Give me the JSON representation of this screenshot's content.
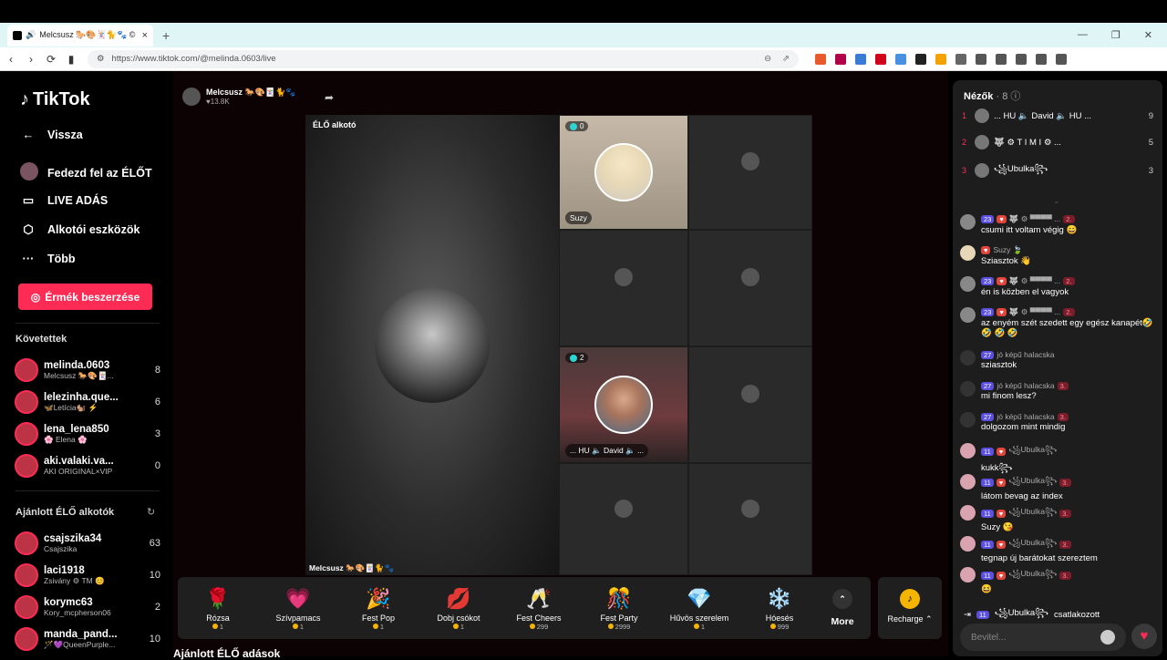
{
  "browser": {
    "tab_title": "Melcsusz 🐎🎨🃏🐈🐾 ©",
    "url": "https://www.tiktok.com/@melinda.0603/live"
  },
  "sidebar": {
    "logo": "TikTok",
    "nav": [
      {
        "label": "Vissza",
        "icon": "arrow-left-icon"
      },
      {
        "label": "Fedezd fel az ÉLŐT",
        "icon": "avatar"
      },
      {
        "label": "LIVE ADÁS",
        "icon": "video-camera-icon"
      },
      {
        "label": "Alkotói eszközök",
        "icon": "creator-tools-icon"
      },
      {
        "label": "Több",
        "icon": "more-dots-icon"
      }
    ],
    "coins_button": "Érmék beszerzése",
    "following_title": "Követettek",
    "following": [
      {
        "name": "melinda.0603",
        "sub": "Melcsusz 🐎🎨🃏...",
        "count": "8"
      },
      {
        "name": "lelezinha.que...",
        "sub": "🦋Letícia🐿️ ⚡",
        "count": "6"
      },
      {
        "name": "lena_lena850",
        "sub": "🌸 Elena 🌸",
        "count": "3"
      },
      {
        "name": "aki.valaki.va...",
        "sub": "AKI ORIGINAL×VIP",
        "count": "0"
      }
    ],
    "suggested_title": "Ajánlott ÉLŐ alkotók",
    "suggested": [
      {
        "name": "csajszika34",
        "sub": "Csajszika",
        "count": "63"
      },
      {
        "name": "laci1918",
        "sub": "Zsivány ⚙ TM 😊",
        "count": "10"
      },
      {
        "name": "korymc63",
        "sub": "Kory_mcpherson06",
        "count": "2"
      },
      {
        "name": "manda_pand...",
        "sub": "🪄💜QueenPurple...",
        "count": "10"
      }
    ]
  },
  "stream": {
    "host_name": "Melcsusz 🐎🎨🃏🐈🐾",
    "host_likes": "♥13.8K",
    "live_label": "ÉLŐ alkotó",
    "video_caption": "Melcsusz 🐎🎨🃏🐈🐾",
    "guest1": {
      "name": "Suzy",
      "badge": "0"
    },
    "guest2": {
      "name": "... HU 🔈 David 🔈 ...",
      "badge": "2"
    }
  },
  "gifts": [
    {
      "name": "Rózsa",
      "price": "1",
      "icon": "🌹"
    },
    {
      "name": "Szívpamacs",
      "price": "1",
      "icon": "💗"
    },
    {
      "name": "Fest Pop",
      "price": "1",
      "icon": "🎉"
    },
    {
      "name": "Dobj csókot",
      "price": "1",
      "icon": "💋"
    },
    {
      "name": "Fest Cheers",
      "price": "299",
      "icon": "🥂"
    },
    {
      "name": "Fest Party",
      "price": "2999",
      "icon": "🎊"
    },
    {
      "name": "Hűvös szerelem",
      "price": "1",
      "icon": "💎"
    },
    {
      "name": "Hóesés",
      "price": "999",
      "icon": "❄️"
    }
  ],
  "more_label": "More",
  "recharge_label": "Recharge ⌃",
  "bottom_heading": "Ajánlott ÉLŐ adások",
  "viewers": {
    "title": "Nézők",
    "count": "· 8",
    "list": [
      {
        "rank": "1",
        "name": "... HU 🔈 David 🔈 HU ...",
        "score": "9"
      },
      {
        "rank": "2",
        "name": "🐺 ⚙   T I M I   ⚙ ...",
        "score": "5"
      },
      {
        "rank": "3",
        "name": "꧁Ubulka꧂",
        "score": "3"
      }
    ]
  },
  "chat": [
    {
      "level": "23",
      "user": "🐺 ⚙ ▀▀▀▀ ...",
      "badge": "2.",
      "text": "csumi itt voltam végig 😄"
    },
    {
      "level": "",
      "user": "Suzy 🍃",
      "badge": "",
      "text": "Sziasztok 👋"
    },
    {
      "level": "23",
      "user": "🐺 ⚙ ▀▀▀▀ ...",
      "badge": "2.",
      "text": "én is közben el vagyok"
    },
    {
      "level": "23",
      "user": "🐺 ⚙ ▀▀▀▀ ...",
      "badge": "2.",
      "text": "az enyém szét szedett egy egész kanapét🤣 🤣 🤣 🤣"
    },
    {
      "level": "27",
      "user": "jó képű halacska",
      "badge": "",
      "text": "sziasztok"
    },
    {
      "level": "27",
      "user": "jó képű halacska",
      "badge": "3.",
      "text": "mi finom lesz?"
    },
    {
      "level": "27",
      "user": "jó képű halacska",
      "badge": "3.",
      "text": "dolgozom mint mindig"
    },
    {
      "level": "11",
      "user": "꧁Ubulka꧂",
      "badge": "",
      "text": "kukk꧂"
    },
    {
      "level": "11",
      "user": "꧁Ubulka꧂",
      "badge": "3.",
      "text": "látom bevag az index"
    },
    {
      "level": "11",
      "user": "꧁Ubulka꧂",
      "badge": "3.",
      "text": "Suzy 😘"
    },
    {
      "level": "11",
      "user": "꧁Ubulka꧂",
      "badge": "3.",
      "text": "tegnap új barátokat szereztem"
    },
    {
      "level": "11",
      "user": "꧁Ubulka꧂",
      "badge": "3.",
      "text": "😆"
    }
  ],
  "join": {
    "level": "11",
    "user": "꧁Ubulka꧂",
    "text": "csatlakozott"
  },
  "input_placeholder": "Bevitel..."
}
